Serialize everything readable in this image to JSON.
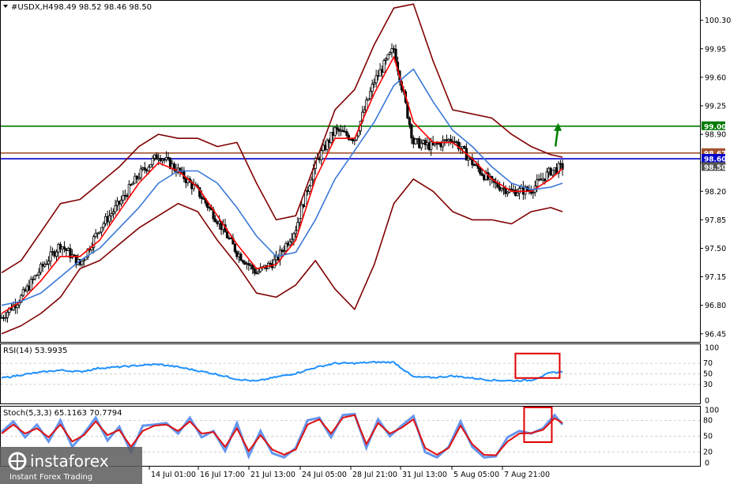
{
  "header": {
    "symbol": "#USDX,H4",
    "ohlc": "98.49 98.52 98.46 98.50"
  },
  "colors": {
    "candle": "#000000",
    "ma_fast": "#ff0000",
    "ma_slow": "#3a78d8",
    "bands": "#800000",
    "support": "#0000cc",
    "resistance_green": "#007a00",
    "resistance_brown": "#a0522d",
    "stoch_main": "#6495ed",
    "stoch_signal": "#e01010",
    "rsi": "#1e90ff",
    "highlight_box": "#e00000",
    "arrow": "#008000"
  },
  "chart_data": [
    {
      "type": "line",
      "name": "price",
      "title": "#USDX,H4",
      "ylim": [
        96.38,
        100.52
      ],
      "yticks": [
        "100.30",
        "99.95",
        "99.60",
        "99.25",
        "98.90",
        "98.55",
        "98.20",
        "97.85",
        "97.50",
        "97.15",
        "96.80",
        "96.45"
      ],
      "xticks": [
        "14 Jul 01:00",
        "16 Jul 17:00",
        "21 Jul 13:00",
        "24 Jul 05:00",
        "28 Jul 21:00",
        "31 Jul 13:00",
        "5 Aug 05:00",
        "7 Aug 21:00"
      ],
      "levels": [
        {
          "label": "99.00",
          "value": 99.0,
          "color": "#007a00"
        },
        {
          "label": "98.67",
          "value": 98.67,
          "color": "#a0522d"
        },
        {
          "label": "98.60",
          "value": 98.6,
          "color": "#0000cc"
        }
      ],
      "current_price": {
        "label": "98.50",
        "value": 98.5
      },
      "series": [
        {
          "role": "close",
          "x": [
            0,
            5,
            10,
            15,
            20,
            25,
            30,
            35,
            40,
            45,
            50,
            55,
            60,
            65,
            70,
            75,
            80,
            85,
            90,
            95,
            100,
            105,
            110,
            115,
            120,
            125,
            130,
            135,
            140,
            143
          ],
          "values": [
            96.65,
            96.9,
            97.25,
            97.55,
            97.3,
            97.75,
            98.05,
            98.4,
            98.65,
            98.45,
            98.2,
            97.85,
            97.45,
            97.2,
            97.35,
            97.75,
            98.55,
            98.95,
            98.85,
            99.55,
            99.95,
            98.8,
            98.75,
            98.85,
            98.55,
            98.3,
            98.2,
            98.22,
            98.45,
            98.5
          ]
        },
        {
          "role": "ma_fast",
          "x": [
            0,
            5,
            10,
            15,
            20,
            25,
            30,
            35,
            40,
            45,
            50,
            55,
            60,
            65,
            70,
            75,
            80,
            85,
            90,
            95,
            100,
            105,
            110,
            115,
            120,
            125,
            130,
            135,
            140,
            143
          ],
          "values": [
            96.7,
            96.85,
            97.1,
            97.4,
            97.4,
            97.6,
            97.95,
            98.3,
            98.55,
            98.45,
            98.25,
            97.9,
            97.55,
            97.25,
            97.3,
            97.6,
            98.35,
            98.85,
            98.85,
            99.4,
            99.85,
            99.05,
            98.8,
            98.8,
            98.6,
            98.35,
            98.2,
            98.2,
            98.35,
            98.48
          ]
        },
        {
          "role": "ma_slow",
          "x": [
            0,
            5,
            10,
            15,
            20,
            25,
            30,
            35,
            40,
            45,
            50,
            55,
            60,
            65,
            70,
            75,
            80,
            85,
            90,
            95,
            100,
            105,
            110,
            115,
            120,
            125,
            130,
            135,
            140,
            143
          ],
          "values": [
            96.8,
            96.85,
            96.95,
            97.15,
            97.35,
            97.5,
            97.75,
            98.0,
            98.3,
            98.45,
            98.45,
            98.3,
            98.0,
            97.65,
            97.4,
            97.45,
            97.85,
            98.35,
            98.7,
            99.05,
            99.5,
            99.7,
            99.3,
            98.95,
            98.75,
            98.5,
            98.3,
            98.22,
            98.25,
            98.3
          ]
        },
        {
          "role": "upper_band",
          "x": [
            0,
            5,
            10,
            15,
            20,
            25,
            30,
            35,
            40,
            45,
            50,
            55,
            60,
            65,
            70,
            75,
            80,
            85,
            90,
            95,
            100,
            105,
            110,
            115,
            120,
            125,
            130,
            135,
            140,
            143
          ],
          "values": [
            97.2,
            97.35,
            97.7,
            98.05,
            98.1,
            98.3,
            98.5,
            98.75,
            98.9,
            98.85,
            98.85,
            98.75,
            98.8,
            98.3,
            97.85,
            97.9,
            98.55,
            99.2,
            99.45,
            100.0,
            100.45,
            100.5,
            99.8,
            99.2,
            99.15,
            99.1,
            98.9,
            98.75,
            98.65,
            98.62
          ]
        },
        {
          "role": "lower_band",
          "x": [
            0,
            5,
            10,
            15,
            20,
            25,
            30,
            35,
            40,
            45,
            50,
            55,
            60,
            65,
            70,
            75,
            80,
            85,
            90,
            95,
            100,
            105,
            110,
            115,
            120,
            125,
            130,
            135,
            140,
            143
          ],
          "values": [
            96.45,
            96.55,
            96.7,
            96.9,
            97.25,
            97.35,
            97.55,
            97.75,
            97.9,
            98.05,
            97.95,
            97.6,
            97.3,
            96.95,
            96.9,
            97.05,
            97.35,
            97.0,
            96.75,
            97.3,
            98.05,
            98.35,
            98.2,
            97.95,
            97.85,
            97.85,
            97.8,
            97.95,
            98.0,
            97.95
          ]
        }
      ]
    },
    {
      "type": "line",
      "name": "rsi",
      "title": "RSI(14) 53.9935",
      "ylim": [
        0,
        100
      ],
      "levels": [
        70,
        50,
        30
      ],
      "yticks": [
        "100",
        "0"
      ],
      "x": [
        0,
        5,
        10,
        15,
        20,
        25,
        30,
        35,
        40,
        45,
        50,
        55,
        60,
        65,
        70,
        75,
        80,
        85,
        90,
        95,
        100,
        105,
        110,
        115,
        120,
        125,
        130,
        135,
        140,
        143
      ],
      "values": [
        42,
        48,
        53,
        57,
        54,
        61,
        63,
        66,
        68,
        63,
        56,
        49,
        40,
        36,
        44,
        51,
        62,
        70,
        70,
        72,
        72,
        44,
        43,
        46,
        42,
        38,
        37,
        38,
        52,
        54
      ]
    },
    {
      "type": "line",
      "name": "stochastic",
      "title": "Stoch(5,3,3) 65.1163 70.7794",
      "ylim": [
        0,
        100
      ],
      "levels": [
        80,
        50,
        20
      ],
      "yticks": [
        "100",
        "0"
      ],
      "series": [
        {
          "name": "main",
          "x": [
            0,
            3,
            6,
            9,
            12,
            15,
            18,
            21,
            24,
            27,
            30,
            33,
            36,
            39,
            42,
            45,
            48,
            51,
            54,
            57,
            60,
            63,
            66,
            69,
            72,
            75,
            78,
            81,
            84,
            87,
            90,
            93,
            96,
            99,
            102,
            105,
            108,
            111,
            114,
            117,
            120,
            123,
            126,
            129,
            132,
            135,
            138,
            141,
            143
          ],
          "values": [
            58,
            78,
            48,
            72,
            40,
            80,
            30,
            55,
            85,
            42,
            68,
            20,
            70,
            72,
            75,
            55,
            85,
            48,
            60,
            22,
            75,
            12,
            60,
            18,
            10,
            28,
            80,
            85,
            48,
            90,
            92,
            28,
            82,
            50,
            70,
            88,
            20,
            10,
            30,
            78,
            30,
            10,
            12,
            48,
            60,
            55,
            65,
            90,
            72
          ]
        },
        {
          "name": "signal",
          "x": [
            0,
            3,
            6,
            9,
            12,
            15,
            18,
            21,
            24,
            27,
            30,
            33,
            36,
            39,
            42,
            45,
            48,
            51,
            54,
            57,
            60,
            63,
            66,
            69,
            72,
            75,
            78,
            81,
            84,
            87,
            90,
            93,
            96,
            99,
            102,
            105,
            108,
            111,
            114,
            117,
            120,
            123,
            126,
            129,
            132,
            135,
            138,
            141,
            143
          ],
          "values": [
            55,
            72,
            55,
            65,
            48,
            72,
            40,
            52,
            78,
            52,
            62,
            30,
            60,
            70,
            72,
            60,
            78,
            55,
            58,
            30,
            65,
            22,
            52,
            25,
            15,
            25,
            72,
            82,
            55,
            85,
            90,
            35,
            75,
            55,
            66,
            82,
            28,
            15,
            28,
            70,
            35,
            15,
            14,
            40,
            55,
            56,
            62,
            84,
            75
          ]
        }
      ]
    }
  ],
  "watermark": {
    "brand": "instaforex",
    "tagline": "Instant Forex Trading"
  }
}
